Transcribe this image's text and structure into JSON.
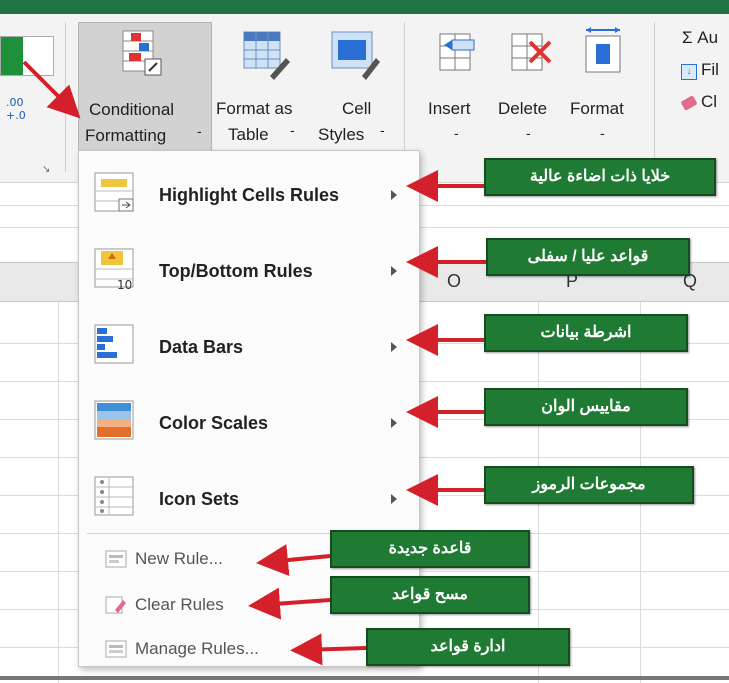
{
  "ribbon": {
    "conditional_formatting": {
      "line1": "Conditional",
      "line2": "Formatting"
    },
    "format_as_table": {
      "line1": "Format as",
      "line2": "Table"
    },
    "cell_styles": {
      "line1": "Cell",
      "line2": "Styles"
    },
    "insert": "Insert",
    "delete": "Delete",
    "format": "Format",
    "editing": {
      "autosum": "Σ Au",
      "fill": "Fil",
      "clear": "Cl"
    },
    "dropdown_marker": "-"
  },
  "columns": [
    "O",
    "P",
    "Q"
  ],
  "menu": {
    "items": [
      {
        "label": "Highlight Cells Rules",
        "icon": "highlight-cells-icon"
      },
      {
        "label": "Top/Bottom Rules",
        "icon": "top-bottom-icon"
      },
      {
        "label": "Data Bars",
        "icon": "data-bars-icon"
      },
      {
        "label": "Color Scales",
        "icon": "color-scales-icon"
      },
      {
        "label": "Icon Sets",
        "icon": "icon-sets-icon"
      }
    ],
    "small_items": [
      {
        "label": "New Rule...",
        "icon": "new-rule-icon"
      },
      {
        "label": "Clear Rules",
        "icon": "clear-rules-icon"
      },
      {
        "label": "Manage Rules...",
        "icon": "manage-rules-icon"
      }
    ]
  },
  "callouts": [
    "خلايا ذات اضاءة عالية",
    "قواعد عليا / سفلى",
    "اشرطة بيانات",
    "مقاييس الوان",
    "مجموعات الرموز",
    "قاعدة جديدة",
    "مسح قواعد",
    "ادارة قواعد"
  ],
  "colors": {
    "callout_green": "#1f7a33",
    "arrow_red": "#d3202a",
    "excel_green": "#217346"
  }
}
